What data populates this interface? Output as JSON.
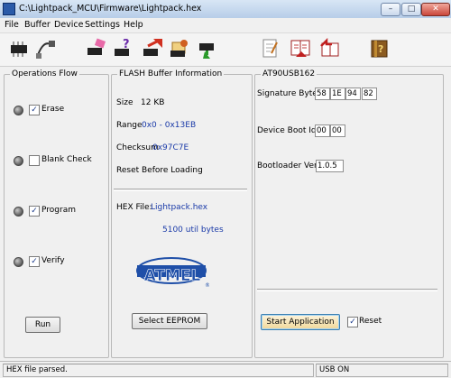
{
  "window": {
    "title": "C:\\Lightpack_MCU\\Firmware\\Lightpack.hex",
    "minimize": "–",
    "maximize": "□",
    "close": "✕"
  },
  "menu": [
    "File",
    "Buffer",
    "Device",
    "Settings",
    "Help"
  ],
  "toolbar": [
    {
      "name": "read-device-icon"
    },
    {
      "name": "usb-cable-icon"
    },
    {
      "name": "erase-chip-icon"
    },
    {
      "name": "blank-check-icon"
    },
    {
      "name": "program-chip-icon"
    },
    {
      "name": "verify-chip-icon"
    },
    {
      "name": "read-chip-icon"
    },
    {
      "name": "edit-buffer-icon"
    },
    {
      "name": "load-hex-book-icon"
    },
    {
      "name": "save-hex-book-icon"
    },
    {
      "name": "help-book-icon"
    }
  ],
  "operations_flow": {
    "title": "Operations Flow",
    "items": [
      {
        "label": "Erase",
        "checked": "✓"
      },
      {
        "label": "Blank Check",
        "checked": ""
      },
      {
        "label": "Program",
        "checked": "✓"
      },
      {
        "label": "Verify",
        "checked": "✓"
      }
    ],
    "run_label": "Run"
  },
  "flash_info": {
    "title": "FLASH Buffer Information",
    "size_label": "Size",
    "size_value": "12 KB",
    "range_label": "Range",
    "range_value": "0x0 - 0x13EB",
    "checksum_label": "Checksum",
    "checksum_value": "0x97C7E",
    "reset_label": "Reset Before Loading",
    "hex_file_label": "HEX File:",
    "hex_file_value": "Lightpack.hex",
    "util_bytes": "5100 util bytes",
    "logo_text": "ATMEL",
    "logo_mark": "®",
    "select_eeprom_label": "Select EEPROM"
  },
  "device": {
    "title": "AT90USB162",
    "signature_label": "Signature Bytes",
    "signature": [
      "58",
      "1E",
      "94",
      "82"
    ],
    "boot_ids_label": "Device Boot Ids",
    "boot_ids": [
      "00",
      "00"
    ],
    "bootloader_label": "Bootloader Ver.",
    "bootloader_value": "1.0.5",
    "start_app_label": "Start Application",
    "reset_label": "Reset",
    "reset_checked": "✓"
  },
  "status": {
    "message": "HEX file parsed.",
    "usb": "USB ON"
  },
  "colors": {
    "link_blue": "#1a3aa8",
    "atmel_blue": "#1f4fa8"
  }
}
